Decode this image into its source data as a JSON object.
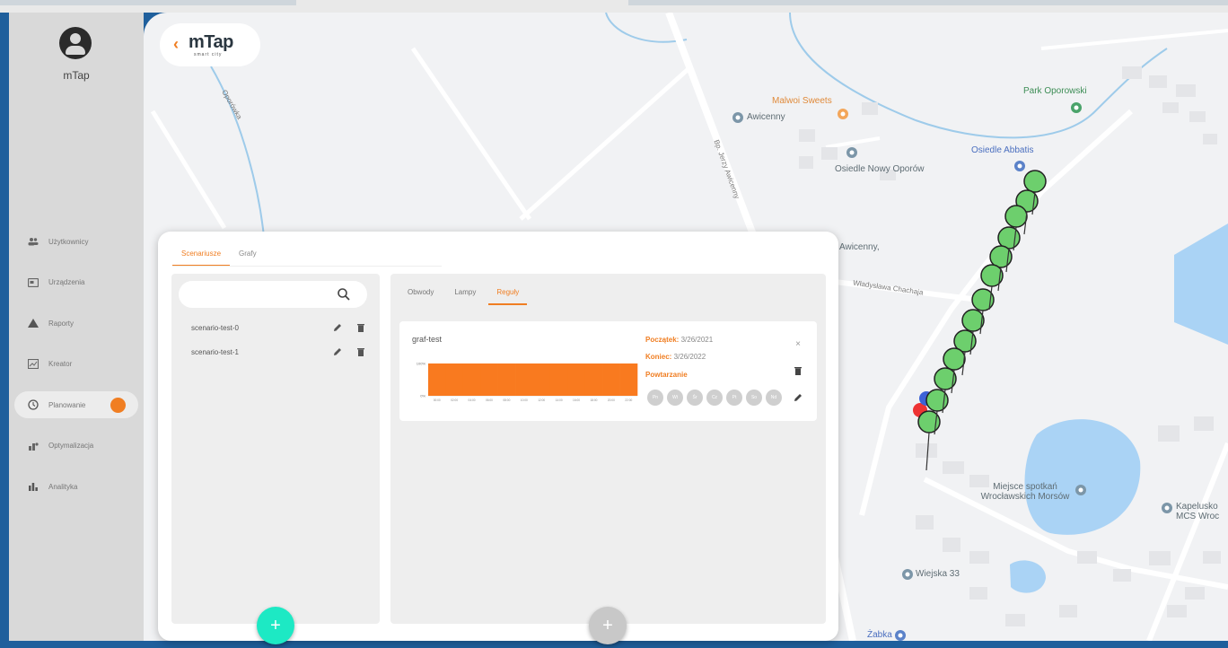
{
  "app": {
    "user_name": "mTap",
    "logo_text": "mTap",
    "logo_subtitle": "smart city"
  },
  "sidebar": {
    "items": [
      {
        "label": "Użytkownicy",
        "icon": "users-icon",
        "active": false
      },
      {
        "label": "Urządzenia",
        "icon": "device-icon",
        "active": false
      },
      {
        "label": "Raporty",
        "icon": "warning-icon",
        "active": false
      },
      {
        "label": "Kreator",
        "icon": "chart-icon",
        "active": false
      },
      {
        "label": "Planowanie",
        "icon": "clock-icon",
        "active": true
      },
      {
        "label": "Optymalizacja",
        "icon": "optimize-icon",
        "active": false
      },
      {
        "label": "Analityka",
        "icon": "analytics-icon",
        "active": false
      }
    ]
  },
  "map": {
    "labels": [
      {
        "text": "Malwoi Sweets",
        "style": "orange"
      },
      {
        "text": "Awicenny",
        "style": "normal"
      },
      {
        "text": "Osiedle Nowy Oporów",
        "style": "normal"
      },
      {
        "text": "Osiedle Abbatis",
        "style": "blue"
      },
      {
        "text": "Park Oporowski",
        "style": "green"
      },
      {
        "text": "Miejsce spotkań Wrocławskich Morsów",
        "style": "normal"
      },
      {
        "text": "Kapelusko MCS Wroc",
        "style": "normal"
      },
      {
        "text": "Wiejska 33",
        "style": "normal"
      },
      {
        "text": "Żabka",
        "style": "blue"
      },
      {
        "text": "Oporówka",
        "style": "street"
      },
      {
        "text": "Bp. Jerzy Awicenny",
        "style": "street"
      },
      {
        "text": "Władysława Chachaja",
        "style": "street"
      },
      {
        "text": "Awicenny,",
        "style": "normal"
      }
    ]
  },
  "panel": {
    "tabs": [
      {
        "label": "Scenariusze",
        "active": true
      },
      {
        "label": "Grafy",
        "active": false
      }
    ],
    "search_placeholder": "",
    "scenarios": [
      {
        "name": "scenario-test-0"
      },
      {
        "name": "scenario-test-1"
      }
    ],
    "detail_tabs": [
      {
        "label": "Obwody",
        "active": false
      },
      {
        "label": "Lampy",
        "active": false
      },
      {
        "label": "Reguły",
        "active": true
      }
    ],
    "rule_card": {
      "title": "graf-test",
      "start_label": "Początek:",
      "start_value": "3/26/2021",
      "end_label": "Koniec:",
      "end_value": "3/26/2022",
      "repeat_label": "Powtarzanie",
      "days": [
        "Pn",
        "Wt",
        "Śr",
        "Cz",
        "Pt",
        "So",
        "Nd"
      ]
    }
  },
  "chart_data": {
    "type": "bar",
    "title": "",
    "categories": [
      "00:00",
      "02:00",
      "04:00",
      "06:00",
      "08:00",
      "10:00",
      "12:00",
      "14:00",
      "16:00",
      "18:00",
      "20:00",
      "22:00"
    ],
    "values": [
      100,
      100,
      100,
      100,
      100,
      100,
      100,
      100,
      100,
      100,
      100,
      100
    ],
    "ylim": [
      0,
      100
    ],
    "yticks": [
      "0%",
      "100%"
    ],
    "color": "#f97a1f"
  },
  "colors": {
    "accent": "#f07e22",
    "fab": "#1de9c4"
  }
}
